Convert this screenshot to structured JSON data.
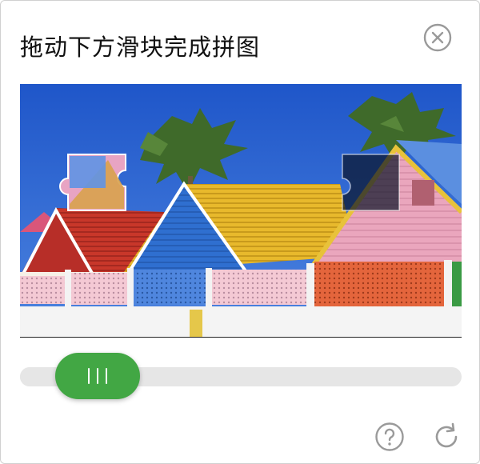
{
  "captcha": {
    "title": "拖动下方滑块完成拼图",
    "slider_progress_percent": 12
  },
  "icons": {
    "close": "close-circle-icon",
    "help": "question-circle-icon",
    "refresh": "refresh-icon",
    "grip": "grip-lines-icon"
  },
  "colors": {
    "accent": "#42a744",
    "track": "#e6e6e6",
    "icon_gray": "#9a9a9a"
  }
}
